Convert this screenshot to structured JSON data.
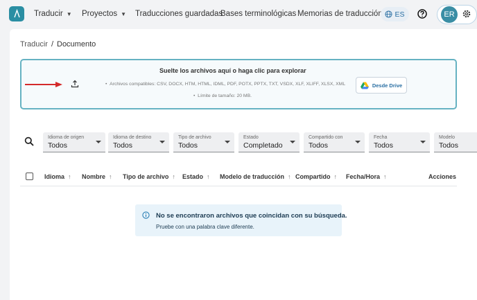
{
  "nav": {
    "items": [
      {
        "label": "Traducir",
        "has_dropdown": true
      },
      {
        "label": "Proyectos",
        "has_dropdown": true
      },
      {
        "label": "Traducciones guardadas",
        "has_dropdown": false
      },
      {
        "label": "Bases terminológicas",
        "has_dropdown": false
      },
      {
        "label": "Memorias de traducción",
        "has_dropdown": false
      }
    ],
    "language": "ES",
    "user_initials": "ER"
  },
  "breadcrumb": {
    "parent": "Traducir",
    "separator": "/",
    "current": "Documento"
  },
  "dropzone": {
    "title": "Suelte los archivos aquí o haga clic para explorar",
    "formats": "Archivos compatibles: CSV, DOCX, HTM, HTML, IDML, PDF, POTX, PPTX, TXT, VSDX, XLF, XLIFF, XLSX, XML",
    "limit": "Límite de tamaño: 20 MB.",
    "drive_button": "Desde Drive"
  },
  "filters": [
    {
      "label": "Idioma de origen",
      "value": "Todos"
    },
    {
      "label": "Idioma de destino",
      "value": "Todos"
    },
    {
      "label": "Tipo de archivo",
      "value": "Todos"
    },
    {
      "label": "Estado",
      "value": "Completado"
    },
    {
      "label": "Compartido con",
      "value": "Todos"
    },
    {
      "label": "Fecha",
      "value": "Todos"
    },
    {
      "label": "Modelo",
      "value": "Todos"
    }
  ],
  "table": {
    "columns": [
      "Idioma",
      "Nombre",
      "Tipo de archivo",
      "Estado",
      "Modelo de traducción",
      "Compartido",
      "Fecha/Hora",
      "Acciones"
    ]
  },
  "empty_state": {
    "title": "No se encontraron archivos que coincidan con su búsqueda.",
    "subtitle": "Pruebe con una palabra clave diferente."
  },
  "colors": {
    "brand": "#2a8ea3",
    "dropzone_border": "#66b2c2",
    "arrow": "#d42a2a",
    "info_bg": "#e8f3fa"
  }
}
